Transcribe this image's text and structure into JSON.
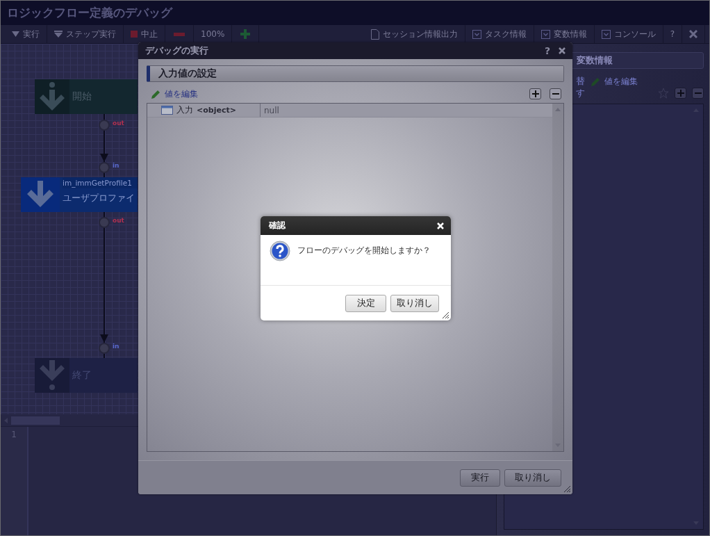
{
  "window": {
    "title": "ロジックフロー定義のデバッグ"
  },
  "toolbar": {
    "left": [
      {
        "kind": "run",
        "label": "実行"
      },
      {
        "kind": "step",
        "label": "ステップ実行"
      },
      {
        "kind": "stop",
        "label": "中止"
      },
      {
        "kind": "zoom-out"
      },
      {
        "kind": "zoom-level",
        "label": "100%"
      },
      {
        "kind": "zoom-in"
      }
    ],
    "right": [
      {
        "kind": "export",
        "label": "セッション情報出力"
      },
      {
        "kind": "toggle",
        "label": "タスク情報"
      },
      {
        "kind": "toggle",
        "label": "変数情報"
      },
      {
        "kind": "toggle",
        "label": "コンソール"
      },
      {
        "kind": "help",
        "label": "?"
      },
      {
        "kind": "close"
      }
    ]
  },
  "canvas": {
    "nodes": [
      {
        "kind": "start",
        "label": "開始"
      },
      {
        "kind": "task",
        "id_label": "im_immGetProfile1",
        "label": "ユーザプロファイ"
      },
      {
        "kind": "end",
        "label": "終了"
      }
    ],
    "ports": [
      {
        "kind": "out",
        "label": "out"
      },
      {
        "kind": "in",
        "label": "in"
      },
      {
        "kind": "out",
        "label": "out"
      },
      {
        "kind": "in",
        "label": "in"
      }
    ]
  },
  "editor": {
    "line_numbers": [
      "1"
    ]
  },
  "variables_panel": {
    "title": "変数情報",
    "fragments": [
      "替",
      "す"
    ],
    "edit_link": "値を編集"
  },
  "debug_dialog": {
    "title": "デバッグの実行",
    "help": "?",
    "section": "入力値の設定",
    "edit_link": "値を編集",
    "rows": [
      {
        "name": "入力",
        "type": "<object>",
        "value": "null"
      }
    ],
    "buttons": [
      "実行",
      "取り消し"
    ]
  },
  "confirm_dialog": {
    "title": "確認",
    "message": "フローのデバッグを開始しますか？",
    "buttons": [
      "決定",
      "取り消し"
    ]
  }
}
